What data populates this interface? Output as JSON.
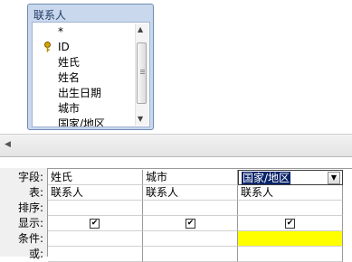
{
  "table": {
    "title": "联系人",
    "fields": [
      "*",
      "ID",
      "姓氏",
      "姓名",
      "出生日期",
      "城市",
      "国家/地区"
    ]
  },
  "grid": {
    "row_headers": [
      "字段:",
      "表:",
      "排序:",
      "显示:",
      "条件:",
      "或:"
    ],
    "columns": [
      {
        "field": "姓氏",
        "table": "联系人",
        "show": true
      },
      {
        "field": "城市",
        "table": "联系人",
        "show": true
      },
      {
        "field": "国家/地区",
        "table": "联系人",
        "show": true
      }
    ],
    "highlight_color": "#ffff00"
  },
  "icons": {
    "key": "key-icon",
    "dropdown": "dropdown-arrow-icon",
    "scroll_up": "scroll-up-icon",
    "scroll_down": "scroll-down-icon",
    "scroll_left": "scroll-left-icon"
  }
}
